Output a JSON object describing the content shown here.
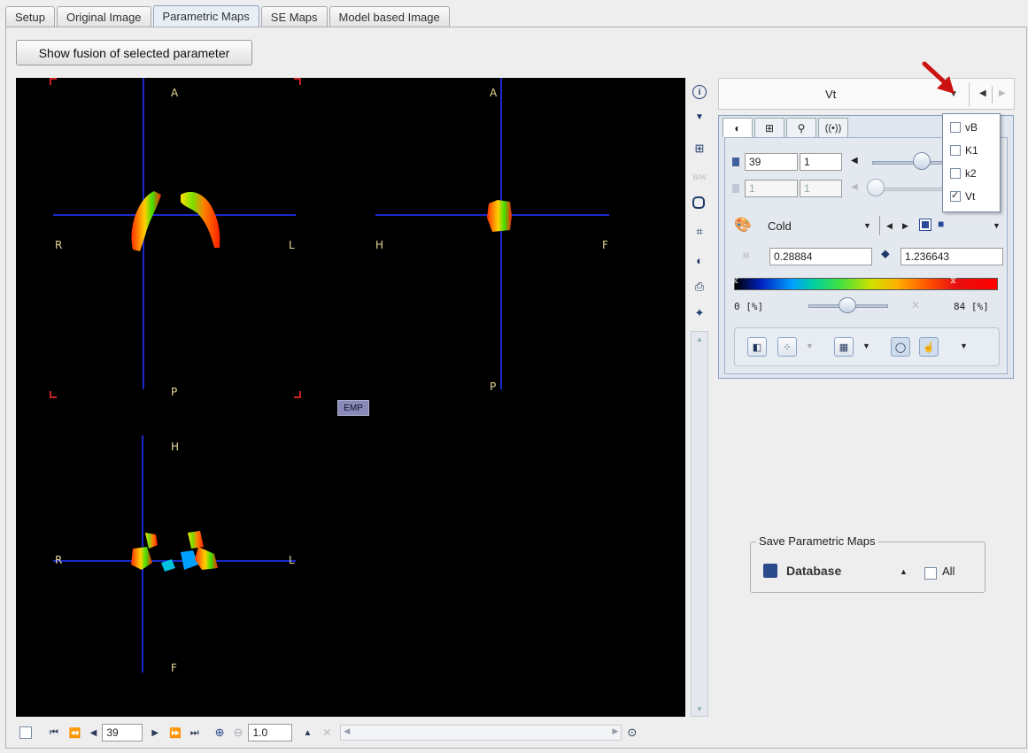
{
  "tabs": [
    {
      "label": "Setup"
    },
    {
      "label": "Original Image"
    },
    {
      "label": "Parametric Maps"
    },
    {
      "label": "SE Maps"
    },
    {
      "label": "Model based Image"
    }
  ],
  "fusion_button": "Show fusion of selected parameter",
  "viewer": {
    "transverse": {
      "top": "A",
      "bottom": "P",
      "left": "R",
      "right": "L"
    },
    "sagittal": {
      "top": "A",
      "bottom": "P",
      "left": "H",
      "right": "F"
    },
    "coronal": {
      "top": "H",
      "bottom": "F",
      "left": "R",
      "right": "L"
    },
    "emp_badge": "EMP"
  },
  "bottom_bar": {
    "slice": "39",
    "zoom": "1.0"
  },
  "parameter_selector": {
    "selected": "Vt"
  },
  "param_dropdown": [
    {
      "label": "vB",
      "checked": false
    },
    {
      "label": "K1",
      "checked": false
    },
    {
      "label": "k2",
      "checked": false
    },
    {
      "label": "Vt",
      "checked": true
    }
  ],
  "control_panel": {
    "slice_value": "39",
    "slice_step": "1",
    "frame_value": "1",
    "frame_step": "1",
    "colormap": "Cold",
    "lower": "0.28884",
    "upper": "1.236643",
    "range_min": "0 [%]",
    "range_max": "84 [%]"
  },
  "save_group": {
    "title": "Save Parametric Maps",
    "target": "Database",
    "all_label": "All"
  },
  "colors": {
    "accent_blue": "#1a2acc",
    "arrow": "#cc1111",
    "background": "#eeeeee"
  }
}
